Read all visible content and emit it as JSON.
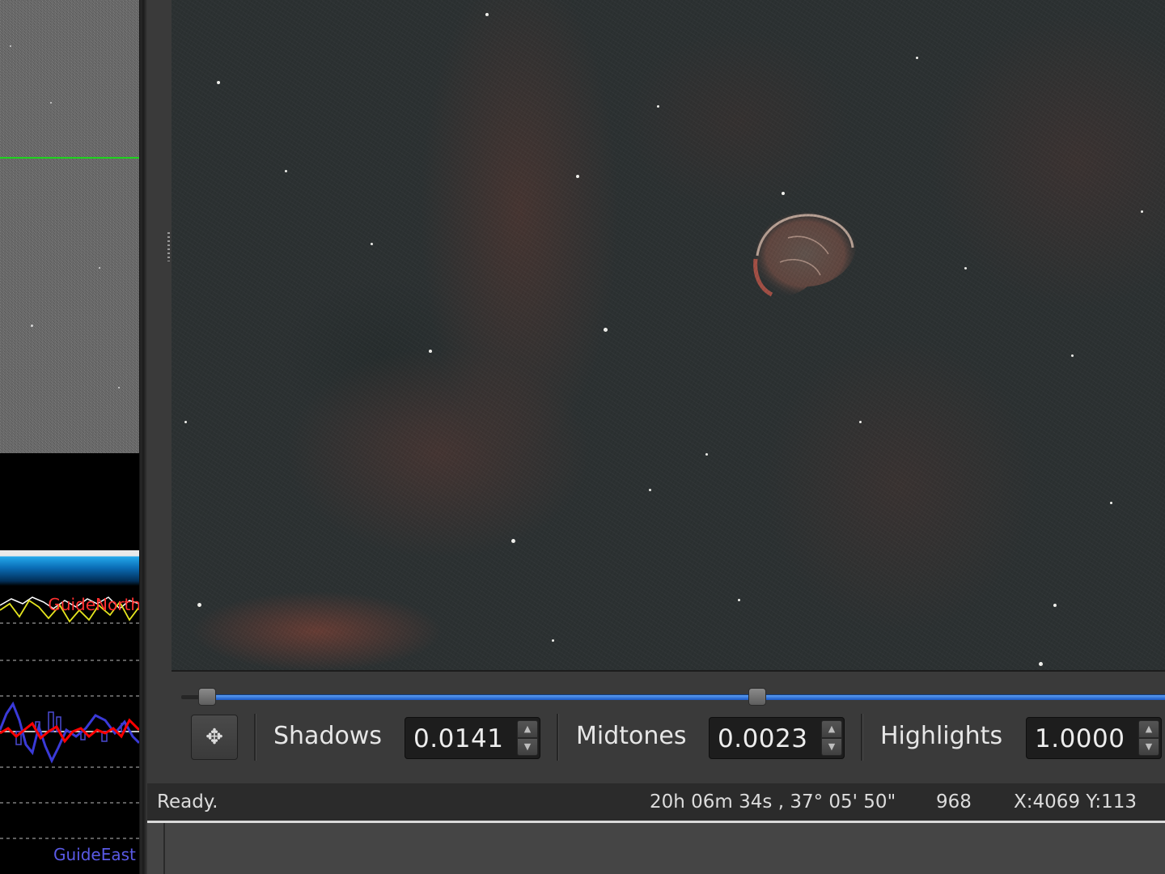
{
  "image_view": {
    "object": "crescent-nebula",
    "palette": {
      "sky": "#2c3132",
      "nebula_red": "#9a4a3a",
      "stars": "#f2f2ee"
    }
  },
  "guide_panel": {
    "guide_line_color": "#1fd21f",
    "graph": {
      "north_label": "GuideNorth",
      "east_label": "GuideEast",
      "north_color": "#ff3030",
      "east_color": "#5a5ae6",
      "ra_line_color": "#ff0000",
      "dec_line_color": "#3a3ad8",
      "trace_white": "#ffffff",
      "trace_yellow": "#e6e61e"
    }
  },
  "stretch": {
    "shadows_label": "Shadows",
    "shadows_value": "0.0141",
    "midtones_label": "Midtones",
    "midtones_value": "0.0023",
    "highlights_label": "Highlights",
    "highlights_value": "1.0000",
    "track_color": "#2f6fd6"
  },
  "status": {
    "message": "Ready.",
    "coordinates": "20h 06m 34s ,  37° 05' 50\"",
    "pixel_value": "968",
    "position": "X:4069 Y:113"
  },
  "icons": {
    "pan": "move-arrows-icon",
    "spin_up": "chevron-up-icon",
    "spin_down": "chevron-down-icon"
  }
}
